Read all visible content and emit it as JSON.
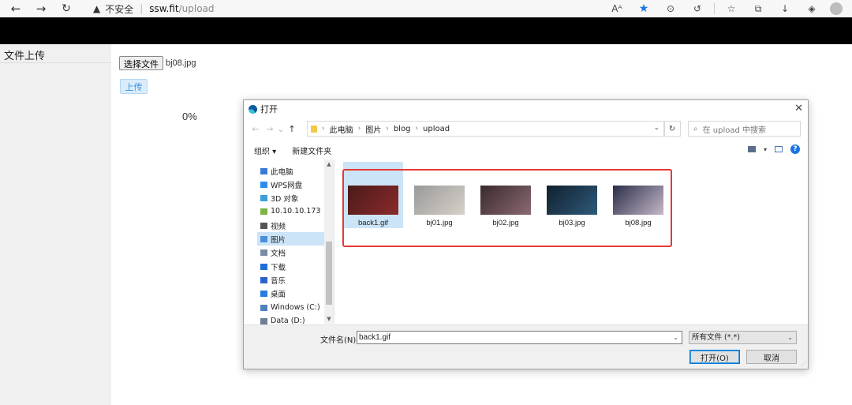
{
  "browser": {
    "security_label": "不安全",
    "host": "ssw.fit",
    "path": "/upload"
  },
  "page": {
    "sidebar_title": "文件上传",
    "choose_file_label": "选择文件",
    "selected_file": "bj08.jpg",
    "upload_label": "上传",
    "progress_text": "0%"
  },
  "dialog": {
    "title": "打开",
    "breadcrumbs": [
      "此电脑",
      "图片",
      "blog",
      "upload"
    ],
    "search_placeholder": "在 upload 中搜索",
    "organize_label": "组织 ▾",
    "new_folder_label": "新建文件夹",
    "nav_items": [
      {
        "label": "此电脑",
        "icon": "computer-icon",
        "color": "#3a7bd5"
      },
      {
        "label": "WPS网盘",
        "icon": "cloud-icon",
        "color": "#2d8cf0"
      },
      {
        "label": "3D 对象",
        "icon": "3d-objects-icon",
        "color": "#3aa0d8"
      },
      {
        "label": "10.10.10.173",
        "icon": "network-drive-icon",
        "color": "#7cb342"
      },
      {
        "label": "视频",
        "icon": "video-icon",
        "color": "#555555"
      },
      {
        "label": "图片",
        "icon": "pictures-icon",
        "color": "#4a90d9"
      },
      {
        "label": "文档",
        "icon": "documents-icon",
        "color": "#7a8ba3"
      },
      {
        "label": "下载",
        "icon": "download-icon",
        "color": "#1e6fd9"
      },
      {
        "label": "音乐",
        "icon": "music-icon",
        "color": "#2a62c9"
      },
      {
        "label": "桌面",
        "icon": "desktop-icon",
        "color": "#2a7be0"
      },
      {
        "label": "Windows (C:)",
        "icon": "drive-c-icon",
        "color": "#4f81bd"
      },
      {
        "label": "Data (D:)",
        "icon": "drive-d-icon",
        "color": "#6d7f95"
      }
    ],
    "selected_nav": "图片",
    "files": [
      {
        "name": "back1.gif",
        "colors": [
          "#4a1a1a",
          "#8c2a2a"
        ],
        "selected": true
      },
      {
        "name": "bj01.jpg",
        "colors": [
          "#9a9a9a",
          "#d8d0c8"
        ],
        "selected": false
      },
      {
        "name": "bj02.jpg",
        "colors": [
          "#3a2a2e",
          "#8a6a70"
        ],
        "selected": false
      },
      {
        "name": "bj03.jpg",
        "colors": [
          "#10202e",
          "#2f5a7a"
        ],
        "selected": false
      },
      {
        "name": "bj08.jpg",
        "colors": [
          "#2a2e4a",
          "#c7b8c8"
        ],
        "selected": false
      }
    ],
    "filename_label": "文件名(N):",
    "filename_value": "back1.gif",
    "filetype_value": "所有文件 (*.*)",
    "open_label": "打开(O)",
    "cancel_label": "取消"
  }
}
